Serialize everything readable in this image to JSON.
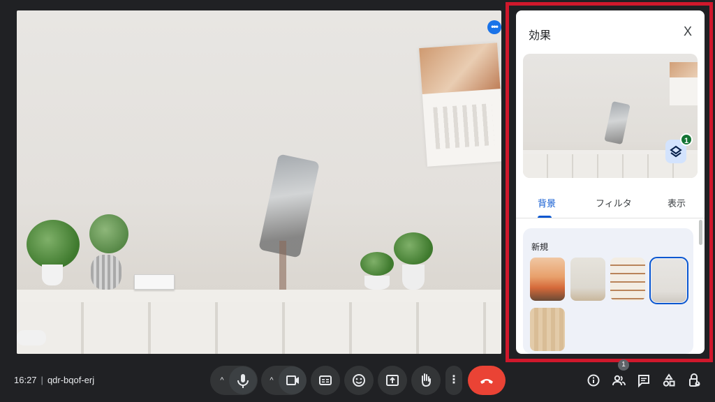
{
  "effects_panel": {
    "title": "効果",
    "close_glyph": "X",
    "layers_badge": "1",
    "tabs": [
      "背景",
      "フィルタ",
      "表示"
    ],
    "active_tab": "背景",
    "section_label": "新規",
    "thumbnails": [
      {
        "name": "orange-living-room",
        "selected": false
      },
      {
        "name": "plain-wall-shelf",
        "selected": false
      },
      {
        "name": "bookshelf-room",
        "selected": false
      },
      {
        "name": "current-room",
        "selected": true
      },
      {
        "name": "wood-panel-room",
        "selected": false
      }
    ]
  },
  "meeting": {
    "time": "16:27",
    "separator": "|",
    "code": "qdr-bqof-erj"
  },
  "controls": {
    "people_count": "1",
    "caret_glyph": "^",
    "more_glyph": "⋮"
  },
  "colors": {
    "accent": "#0b57d0",
    "highlight_frame": "#d0182c",
    "end_call": "#ea4335",
    "badge_green": "#137333"
  }
}
